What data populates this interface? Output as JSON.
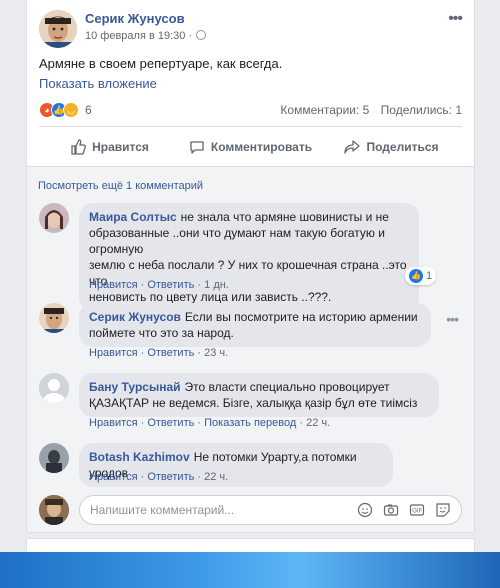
{
  "post": {
    "author": "Серик Жунусов",
    "time": "10 февраля в 19:30 ·",
    "text": "Армяне в своем репертуаре, как всегда.",
    "attachment_link": "Показать вложение",
    "reaction_count": "6",
    "comments_count": "Комментарии: 5",
    "shares_count": "Поделились: 1"
  },
  "actions": {
    "like": "Нравится",
    "comment": "Комментировать",
    "share": "Поделиться"
  },
  "more_comments": "Посмотреть ещё 1 комментарий",
  "comments": [
    {
      "name": "Маира Солтыс",
      "text_lines": [
        "не знала что армяне шовинисты и не",
        "образованные ..они что думают нам такую богатую и огромную",
        "землю с неба послали ? У них то крошечная страна ..это что",
        "неновисть по цвету лица или зависть ..???."
      ],
      "like": "Нравится",
      "reply": "Ответить",
      "time": "1 дн.",
      "likes": "1"
    },
    {
      "name": "Серик Жунусов",
      "text_lines": [
        "Если вы посмотрите на историю армении",
        "поймете что это за народ."
      ],
      "like": "Нравится",
      "reply": "Ответить",
      "time": "23 ч."
    },
    {
      "name": "Бану Турсынай",
      "text_lines": [
        "Это власти специально провоцирует",
        "ҚАЗАҚТАР не ведемся. Бізге, халыққа қазір бұл өте тиімсіз"
      ],
      "like": "Нравится",
      "reply": "Ответить",
      "translate": "Показать перевод",
      "time": "22 ч."
    },
    {
      "name": "Botash Kazhimov",
      "text_lines": [
        "Не потомки Урарту,а потомки уродов"
      ],
      "like": "Нравится",
      "reply": "Ответить",
      "time": "22 ч."
    }
  ],
  "composer": {
    "placeholder": "Напишите комментарий..."
  },
  "colors": {
    "link": "#385898",
    "like_blue": "#1877f2",
    "angry": "#f0562a",
    "haha": "#f7b125"
  },
  "icons": [
    "globe-icon",
    "more-icon",
    "angry-reaction-icon",
    "like-reaction-icon",
    "haha-reaction-icon",
    "thumbs-up-icon",
    "comment-icon",
    "share-icon",
    "emoji-icon",
    "camera-icon",
    "gif-icon",
    "sticker-icon"
  ]
}
